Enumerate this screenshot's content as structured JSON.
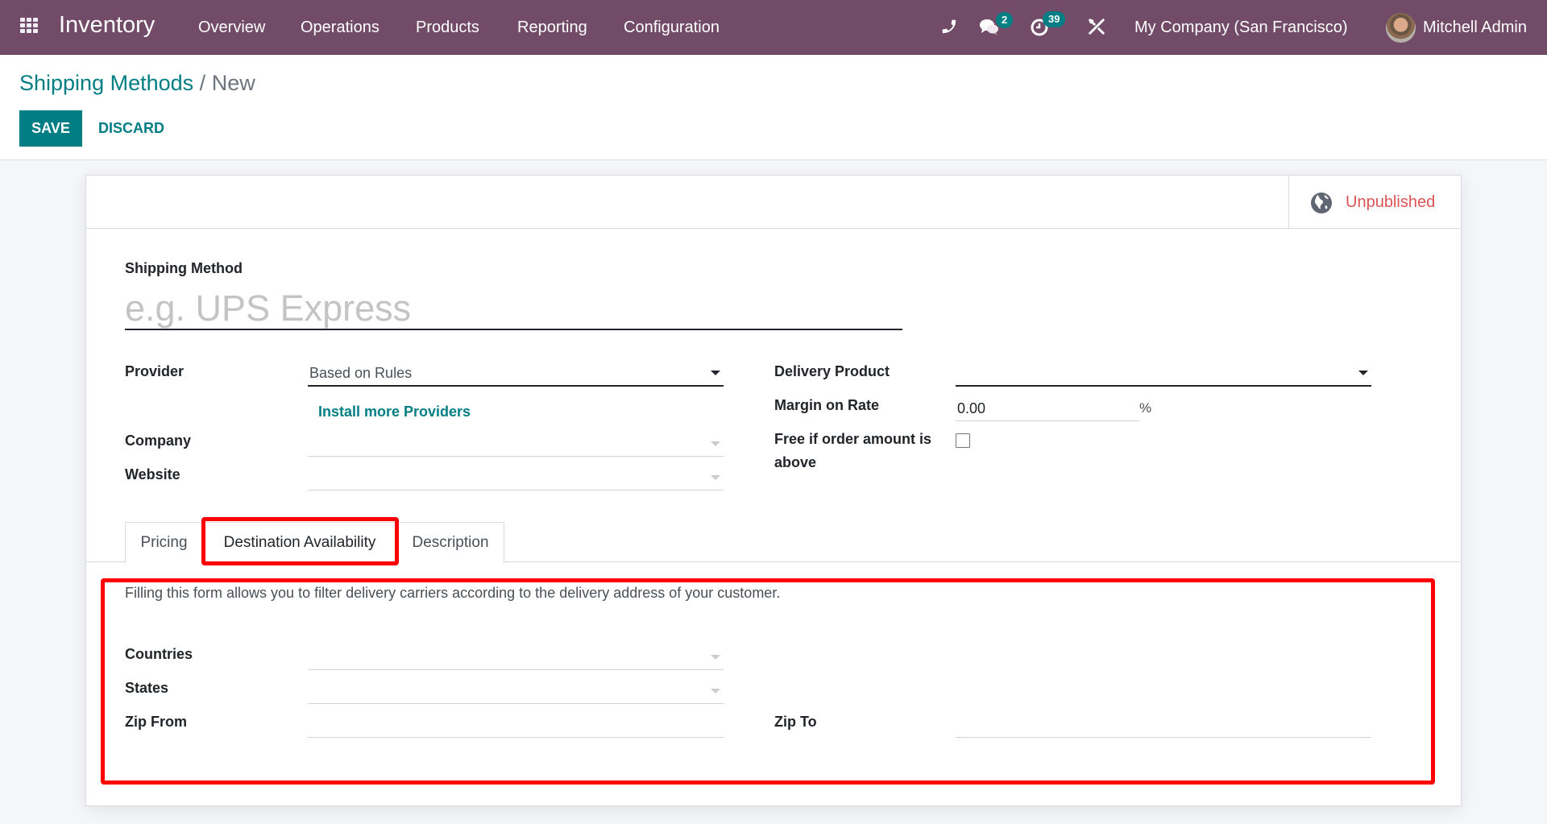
{
  "navbar": {
    "app_name": "Inventory",
    "menu": [
      "Overview",
      "Operations",
      "Products",
      "Reporting",
      "Configuration"
    ],
    "icons": {
      "apps": "apps-grid-icon",
      "phone": "phone-icon",
      "chat": "chat-icon",
      "activity": "activity-clock-icon",
      "tools": "debug-tools-icon"
    },
    "chat_badge": "2",
    "activity_badge": "39",
    "company": "My Company (San Francisco)",
    "user": "Mitchell Admin",
    "color": "#714b67"
  },
  "control_panel": {
    "breadcrumb_parent": "Shipping Methods",
    "breadcrumb_separator": "/",
    "breadcrumb_current": "New",
    "save_label": "SAVE",
    "discard_label": "DISCARD",
    "accent": "#017e84"
  },
  "sheet": {
    "status_button": {
      "icon": "globe-icon",
      "label": "Unpublished",
      "color": "#dc5353"
    },
    "name_label": "Shipping Method",
    "name_placeholder": "e.g. UPS Express",
    "left_fields": {
      "provider_label": "Provider",
      "provider_value": "Based on Rules",
      "install_link": "Install more Providers",
      "company_label": "Company",
      "company_value": "",
      "website_label": "Website",
      "website_value": ""
    },
    "right_fields": {
      "delivery_product_label": "Delivery Product",
      "delivery_product_value": "",
      "margin_label": "Margin on Rate",
      "margin_value": "0.00",
      "margin_unit": "%",
      "free_label_line1": "Free if order amount is",
      "free_label_line2": "above",
      "free_checked": false
    },
    "tabs": [
      {
        "label": "Pricing",
        "active": false
      },
      {
        "label": "Destination Availability",
        "active": true
      },
      {
        "label": "Description",
        "active": false
      }
    ],
    "destination": {
      "help_text": "Filling this form allows you to filter delivery carriers according to the delivery address of your customer.",
      "countries_label": "Countries",
      "countries_value": "",
      "states_label": "States",
      "states_value": "",
      "zip_from_label": "Zip From",
      "zip_from_value": "",
      "zip_to_label": "Zip To",
      "zip_to_value": ""
    },
    "annotation_color": "#ff0000"
  }
}
